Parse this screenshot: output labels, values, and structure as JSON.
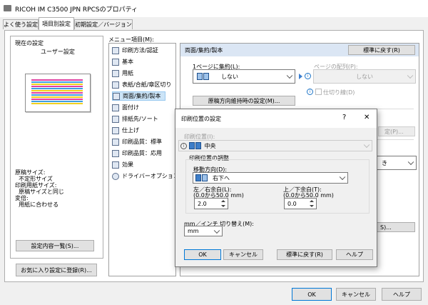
{
  "window": {
    "title": "RICOH IM C3500 JPN RPCSのプロパティ",
    "tabs": [
      "よく使う設定",
      "項目別設定",
      "初期設定／バージョン"
    ],
    "current_settings_label": "現在の設定",
    "user_settings_label": "ユーザー設定",
    "summary_lines": [
      "原稿サイズ:",
      "  不定形サイズ",
      "印刷用紙サイズ:",
      "  原稿サイズと同じ",
      "変倍:",
      "  用紙に合わせる"
    ],
    "list_settings_button": "設定内容一覧(S)...",
    "favorites_button": "お気に入り設定に登録(R)...",
    "menu_label": "メニュー項目(M):",
    "menu_items": [
      "印刷方法/認証",
      "基本",
      "用紙",
      "表紙/合紙/章区切り",
      "両面/集約/製本",
      "面付け",
      "排紙先/ソート",
      "仕上げ",
      "印刷品質：標準",
      "印刷品質：応用",
      "効果",
      "ドライバーオプション"
    ],
    "selected_menu_index": 4,
    "section_title": "両面/集約/製本",
    "reset_default_button": "標準に戻す(R)",
    "pages_per_sheet_label": "1ページに集約(L):",
    "pages_per_sheet_value": "しない",
    "page_order_label": "ページの配列(P):",
    "page_order_value": "しない",
    "border_checkbox": "仕切り線(D)",
    "position_settings_button": "原稿方向維持時の設定(M)...",
    "partial_button_1": "定(P)...",
    "partial_text_1": "き",
    "partial_button_2": "S)...",
    "ok_button": "OK",
    "cancel_button": "キャンセル",
    "help_button": "ヘルプ"
  },
  "dialog": {
    "title": "印刷位置の設定",
    "help_glyph": "?",
    "close_glyph": "✕",
    "print_position_label": "印刷位置(I):",
    "print_position_value": "中央",
    "adjust_group_label": "印刷位置の調整",
    "direction_label": "移動方向(D):",
    "direction_value": "右下へ",
    "lr_margin_label": "左／右余白(L):",
    "lr_margin_range": "(0.0から50.0 mm)",
    "lr_margin_value": "2.0",
    "tb_margin_label": "上／下余白(T):",
    "tb_margin_range": "(0.0から50.0 mm)",
    "tb_margin_value": "0.0",
    "unit_label": "mm／インチ 切り替え(M):",
    "unit_value": "mm",
    "ok_button": "OK",
    "cancel_button": "キャンセル",
    "reset_button": "標準に戻す(R)",
    "help_button": "ヘルプ"
  }
}
